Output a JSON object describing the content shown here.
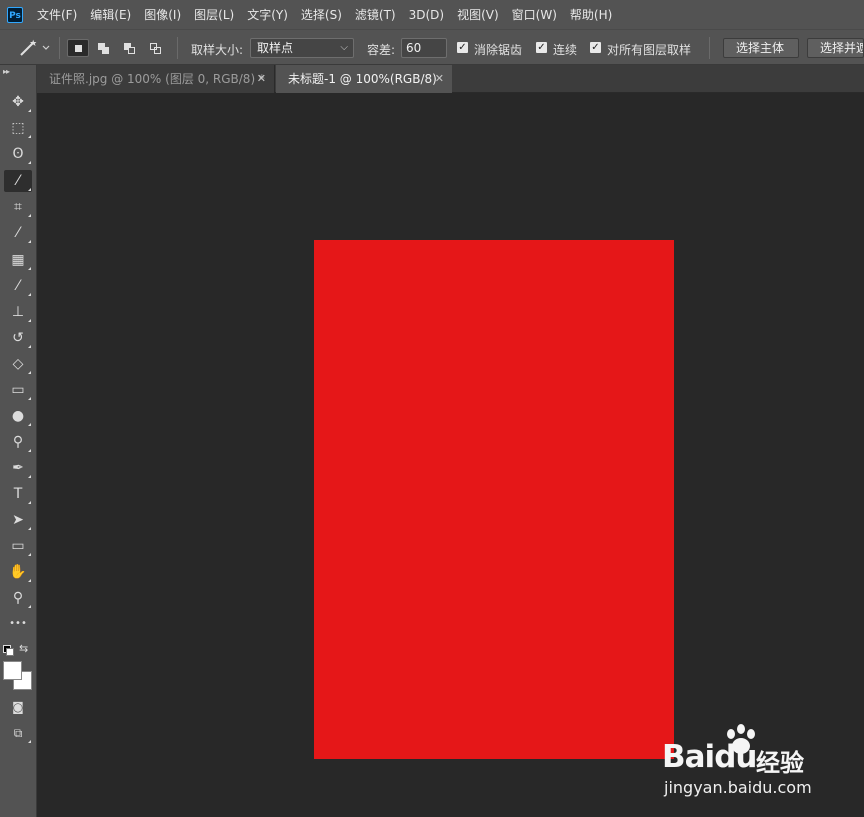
{
  "app": {
    "logo_text": "Ps"
  },
  "menu": [
    "文件(F)",
    "编辑(E)",
    "图像(I)",
    "图层(L)",
    "文字(Y)",
    "选择(S)",
    "滤镜(T)",
    "3D(D)",
    "视图(V)",
    "窗口(W)",
    "帮助(H)"
  ],
  "options": {
    "tool_icon": "magic-wand-icon",
    "sample_size_label": "取样大小:",
    "sample_size_value": "取样点",
    "tolerance_label": "容差:",
    "tolerance_value": "60",
    "anti_alias_label": "消除锯齿",
    "anti_alias_checked": true,
    "contiguous_label": "连续",
    "contiguous_checked": true,
    "sample_all_layers_label": "对所有图层取样",
    "sample_all_layers_checked": true,
    "select_subject_label": "选择主体",
    "select_and_mask_label": "选择并遮住"
  },
  "tabs": [
    {
      "label": "证件照.jpg @ 100% (图层 0, RGB/8) *",
      "active": false
    },
    {
      "label": "未标题-1 @ 100%(RGB/8)",
      "active": true
    }
  ],
  "tools": [
    {
      "name": "move-tool-icon",
      "glyph": "✥"
    },
    {
      "name": "marquee-tool-icon",
      "glyph": "⬚"
    },
    {
      "name": "lasso-tool-icon",
      "glyph": "ʘ"
    },
    {
      "name": "magic-wand-tool-icon",
      "glyph": "⁄"
    },
    {
      "name": "crop-tool-icon",
      "glyph": "⌗"
    },
    {
      "name": "eyedropper-tool-icon",
      "glyph": "⁄"
    },
    {
      "name": "healing-brush-tool-icon",
      "glyph": "▦"
    },
    {
      "name": "brush-tool-icon",
      "glyph": "⁄"
    },
    {
      "name": "clone-stamp-tool-icon",
      "glyph": "⊥"
    },
    {
      "name": "history-brush-tool-icon",
      "glyph": "↺"
    },
    {
      "name": "eraser-tool-icon",
      "glyph": "◇"
    },
    {
      "name": "gradient-tool-icon",
      "glyph": "▭"
    },
    {
      "name": "blur-tool-icon",
      "glyph": "●"
    },
    {
      "name": "dodge-tool-icon",
      "glyph": "⚲"
    },
    {
      "name": "pen-tool-icon",
      "glyph": "✒"
    },
    {
      "name": "type-tool-icon",
      "glyph": "T"
    },
    {
      "name": "path-selection-tool-icon",
      "glyph": "➤"
    },
    {
      "name": "rectangle-tool-icon",
      "glyph": "▭"
    },
    {
      "name": "hand-tool-icon",
      "glyph": "✋"
    },
    {
      "name": "zoom-tool-icon",
      "glyph": "⚲"
    },
    {
      "name": "more-tools-icon",
      "glyph": "•••"
    }
  ],
  "colors": {
    "canvas_fill": "#e51718",
    "foreground": "#ffffff",
    "background": "#ffffff",
    "ui_panel": "#535353",
    "workspace": "#282828"
  },
  "watermark": {
    "logo": "Bai",
    "logo_suffix": "du",
    "text": "经验",
    "url": "jingyan.baidu.com"
  }
}
